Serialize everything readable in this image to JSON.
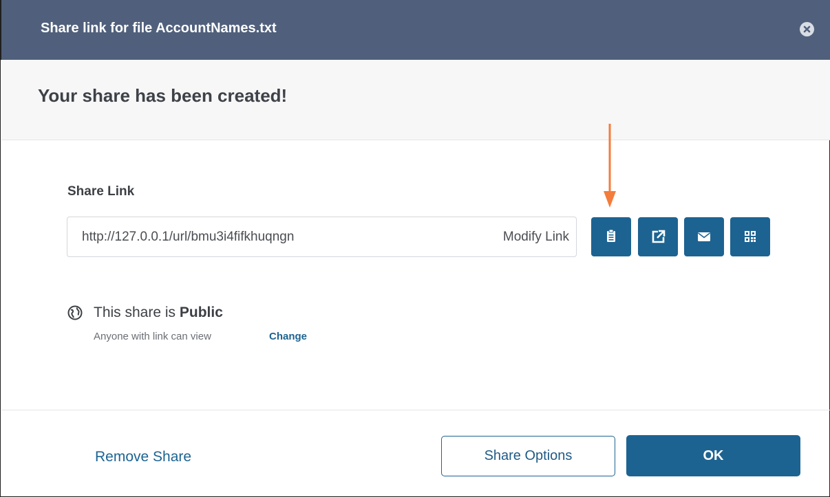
{
  "dialog": {
    "title": "Share link for file AccountNames.txt",
    "close_icon": "close-icon"
  },
  "header": {
    "heading": "Your share has been created!"
  },
  "share_link": {
    "label": "Share Link",
    "url": "http://127.0.0.1/url/bmu3i4fifkhuqngn",
    "modify_label": "Modify Link",
    "action_icons": [
      "clipboard-icon",
      "external-link-icon",
      "envelope-icon",
      "qr-code-icon"
    ]
  },
  "visibility": {
    "prefix": "This share is",
    "level": "Public",
    "description": "Anyone with link can view",
    "change_label": "Change",
    "icon": "globe-icon"
  },
  "footer": {
    "remove_label": "Remove Share",
    "options_label": "Share Options",
    "ok_label": "OK"
  },
  "colors": {
    "title_bar": "#50607c",
    "accent": "#1d6391",
    "annotation_arrow": "#f47c3c"
  }
}
